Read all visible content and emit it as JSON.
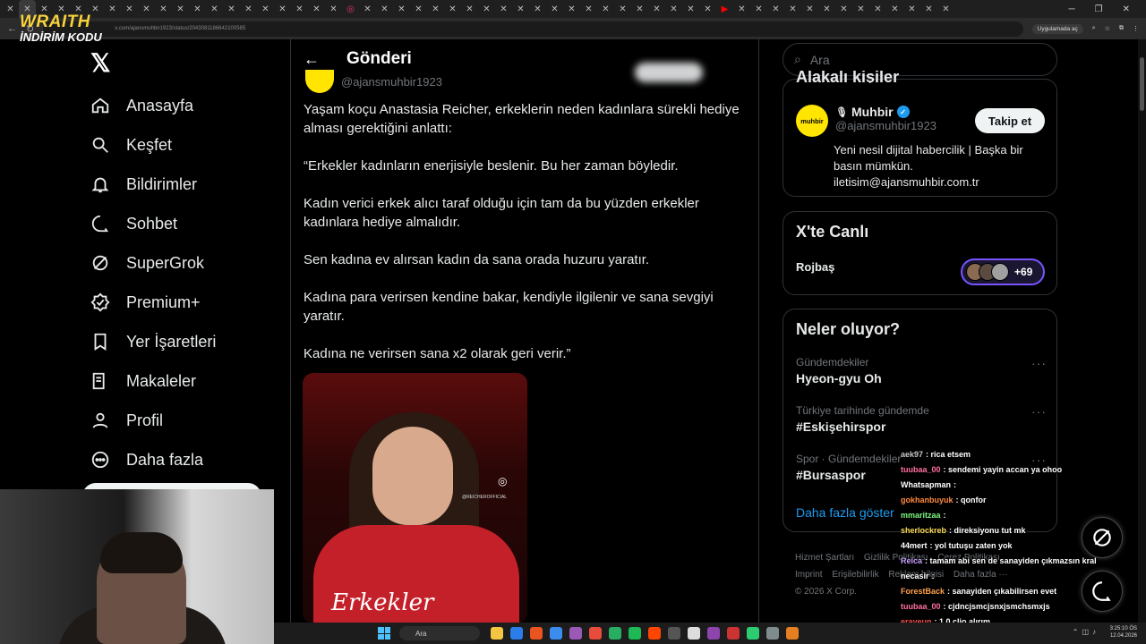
{
  "browser": {
    "tabs_count": 56,
    "url": "x.com/ajansmuhbir1923/status/2043081186642100585",
    "app_pill": "Uygulamada aç"
  },
  "overlay": {
    "brand_line1": "WRAITH",
    "brand_line2": "İNDİRİM KODU"
  },
  "sidebar": {
    "items": [
      {
        "label": "Anasayfa",
        "icon": "home-icon"
      },
      {
        "label": "Keşfet",
        "icon": "search-icon"
      },
      {
        "label": "Bildirimler",
        "icon": "bell-icon"
      },
      {
        "label": "Sohbet",
        "icon": "chat-icon"
      },
      {
        "label": "SuperGrok",
        "icon": "grok-icon"
      },
      {
        "label": "Premium+",
        "icon": "premium-icon"
      },
      {
        "label": "Yer İşaretleri",
        "icon": "bookmark-icon"
      },
      {
        "label": "Makaleler",
        "icon": "articles-icon"
      },
      {
        "label": "Profil",
        "icon": "profile-icon"
      },
      {
        "label": "Daha fazla",
        "icon": "more-icon"
      }
    ]
  },
  "main": {
    "title": "Gönderi",
    "author_handle": "@ajansmuhbir1923",
    "paragraphs": [
      "Yaşam koçu Anastasia Reicher, erkeklerin neden kadınlara sürekli hediye alması gerektiğini anlattı:",
      "“Erkekler kadınların enerjisiyle beslenir. Bu her zaman böyledir.",
      "Kadın verici erkek alıcı taraf olduğu için tam da bu yüzden erkekler kadınlara hediye almalıdır.",
      "Sen kadına ev alırsan kadın da sana orada huzuru yaratır.",
      "Kadına para verirsen kendine bakar, kendiyle ilgilenir ve sana sevgiyi yaratır.",
      "Kadına ne verirsen sana x2 olarak geri verir.”"
    ],
    "media": {
      "watermark": "@REICHEROFFICIAL",
      "caption": "Erkekler"
    }
  },
  "right": {
    "search_placeholder": "Ara",
    "related": {
      "title": "Alakalı kişiler",
      "name": "Muhbir",
      "handle": "@ajansmuhbir1923",
      "avatar_text": "muhbir",
      "bio": "Yeni nesil dijital habercilik | Başka bir basın mümkün. iletisim@ajansmuhbir.com.tr",
      "follow_label": "Takip et"
    },
    "live": {
      "title": "X'te Canlı",
      "name": "Rojbaş",
      "count": "+69"
    },
    "trends": {
      "title": "Neler oluyor?",
      "items": [
        {
          "meta": "Gündemdekiler",
          "name": "Hyeon-gyu Oh"
        },
        {
          "meta": "Türkiye tarihinde gündemde",
          "name": "#Eskişehirspor"
        },
        {
          "meta": "Spor · Gündemdekiler",
          "name": "#Bursaspor"
        }
      ],
      "show_more": "Daha fazla göster"
    },
    "footer": {
      "links_row1": [
        "Hizmet Şartları",
        "Gizlilik Politikası",
        "Çerez Politikası"
      ],
      "links_row2": [
        "Imprint",
        "Erişilebilirlik",
        "Reklam bilgisi",
        "Daha fazla ···"
      ],
      "copyright": "© 2026 X Corp."
    }
  },
  "chat": [
    {
      "user": "aek97",
      "msg": ": rica etsem",
      "color": "#c6c6c6"
    },
    {
      "user": "tuubaa_00",
      "msg": ": sendemi yayin accan ya ohoo",
      "color": "#ff6fa0"
    },
    {
      "user": "Whatsapman",
      "msg": ":",
      "color": "#ffffff"
    },
    {
      "user": "gokhanbuyuk",
      "msg": ": qonfor",
      "color": "#ff8a3d"
    },
    {
      "user": "mmaritzaa",
      "msg": ":",
      "color": "#7cf77c"
    },
    {
      "user": "sherlockreb",
      "msg": ": direksiyonu tut mk",
      "color": "#ffde59"
    },
    {
      "user": "44mert",
      "msg": ": yol tutuşu zaten yok",
      "color": "#ffffff"
    },
    {
      "user": "Reica",
      "msg": ": tamam abi sen de sanayiden çıkmazsın kral",
      "color": "#c8a0ff"
    },
    {
      "user": "necasir",
      "msg": ":",
      "color": "#ffffff"
    },
    {
      "user": "ForestBack",
      "msg": ": sanayiden çıkabilirsen evet",
      "color": "#ffa24d"
    },
    {
      "user": "tuubaa_00",
      "msg": ": cjdncjsmcjsnxjsmchsmxjs",
      "color": "#ff6fa0"
    },
    {
      "user": "erayeun",
      "msg": ": 1.0 clio alırım",
      "color": "#ff4d4d"
    }
  ],
  "taskbar": {
    "search": "Ara",
    "time": "3:25:10 ÖS",
    "date": "12.04.2026"
  }
}
